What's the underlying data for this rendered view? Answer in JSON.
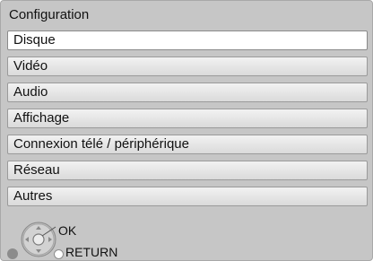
{
  "header": {
    "title": "Configuration"
  },
  "menu": {
    "items": [
      {
        "label": "Disque",
        "selected": true
      },
      {
        "label": "Vidéo",
        "selected": false
      },
      {
        "label": "Audio",
        "selected": false
      },
      {
        "label": "Affichage",
        "selected": false
      },
      {
        "label": "Connexion télé / périphérique",
        "selected": false
      },
      {
        "label": "Réseau",
        "selected": false
      },
      {
        "label": "Autres",
        "selected": false
      }
    ]
  },
  "footer": {
    "ok_label": "OK",
    "return_label": "RETURN",
    "icons": [
      "directional-pad-icon",
      "return-button-icon",
      "option-dot-icon"
    ]
  },
  "colors": {
    "panel_background": "#c6c6c6",
    "item_background": "#e8e8e8",
    "selected_background": "#ffffff",
    "text": "#111111"
  }
}
